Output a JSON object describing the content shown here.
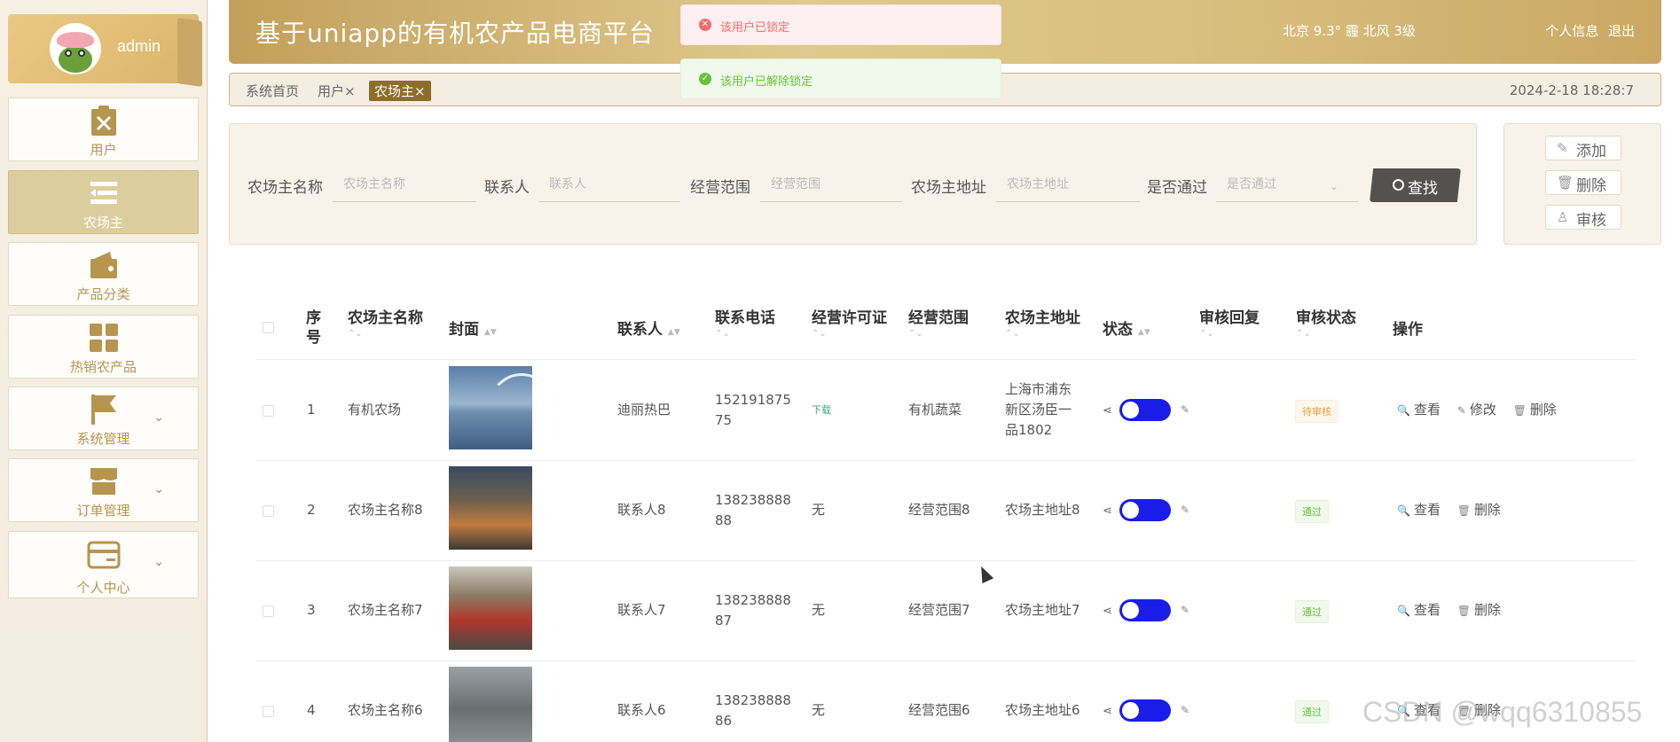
{
  "sidebar": {
    "admin_name": "admin",
    "items": [
      {
        "label": "用户",
        "icon": "user-clipboard-icon"
      },
      {
        "label": "农场主",
        "icon": "list-menu-icon"
      },
      {
        "label": "产品分类",
        "icon": "wallet-icon"
      },
      {
        "label": "热销农产品",
        "icon": "grid-icon"
      },
      {
        "label": "系统管理",
        "icon": "flag-icon"
      },
      {
        "label": "订单管理",
        "icon": "store-icon"
      },
      {
        "label": "个人中心",
        "icon": "card-icon"
      }
    ]
  },
  "header": {
    "title": "基于uniapp的有机农产品电商平台",
    "weather": "北京  9.3°  霾  北风  3级",
    "profile": "个人信息",
    "logout": "退出"
  },
  "toasts": {
    "error": "该用户已锁定",
    "success": "该用户已解除锁定"
  },
  "tabs": {
    "items": [
      "系统首页",
      "用户",
      "农场主"
    ],
    "close": "×",
    "datetime": "2024-2-18 18:28:7"
  },
  "search": {
    "fields": [
      {
        "label": "农场主名称",
        "placeholder": "农场主名称"
      },
      {
        "label": "联系人",
        "placeholder": "联系人"
      },
      {
        "label": "经营范围",
        "placeholder": "经营范围"
      },
      {
        "label": "农场主地址",
        "placeholder": "农场主地址"
      },
      {
        "label": "是否通过",
        "placeholder": "是否通过"
      }
    ],
    "button": "查找"
  },
  "actions": {
    "add": "添加",
    "delete": "删除",
    "review": "审核"
  },
  "table": {
    "headers": [
      "序号",
      "农场主名称",
      "封面",
      "联系人",
      "联系电话",
      "经营许可证",
      "经营范围",
      "农场主地址",
      "状态",
      "审核回复",
      "审核状态",
      "操作"
    ],
    "rows": [
      {
        "no": "1",
        "name": "有机农场",
        "contact": "迪丽热巴",
        "phone": "15219187575",
        "license": "下载",
        "scope": "有机蔬菜",
        "address": "上海市浦东新区汤臣一品1802",
        "status_text": "待审核",
        "ops": [
          "查看",
          "修改",
          "删除"
        ]
      },
      {
        "no": "2",
        "name": "农场主名称8",
        "contact": "联系人8",
        "phone": "13823888888",
        "license": "无",
        "scope": "经营范围8",
        "address": "农场主地址8",
        "status_text": "通过",
        "ops": [
          "查看",
          "删除"
        ]
      },
      {
        "no": "3",
        "name": "农场主名称7",
        "contact": "联系人7",
        "phone": "13823888887",
        "license": "无",
        "scope": "经营范围7",
        "address": "农场主地址7",
        "status_text": "通过",
        "ops": [
          "查看",
          "删除"
        ]
      },
      {
        "no": "4",
        "name": "农场主名称6",
        "contact": "联系人6",
        "phone": "13823888886",
        "license": "无",
        "scope": "经营范围6",
        "address": "农场主地址6",
        "status_text": "通过",
        "ops": [
          "查看",
          "删除"
        ]
      }
    ]
  },
  "watermark": "CSDN @wqq6310855",
  "colors": {
    "accent": "#8d6d2a",
    "toggle": "#1a1de8",
    "header": "#d8be7e"
  }
}
